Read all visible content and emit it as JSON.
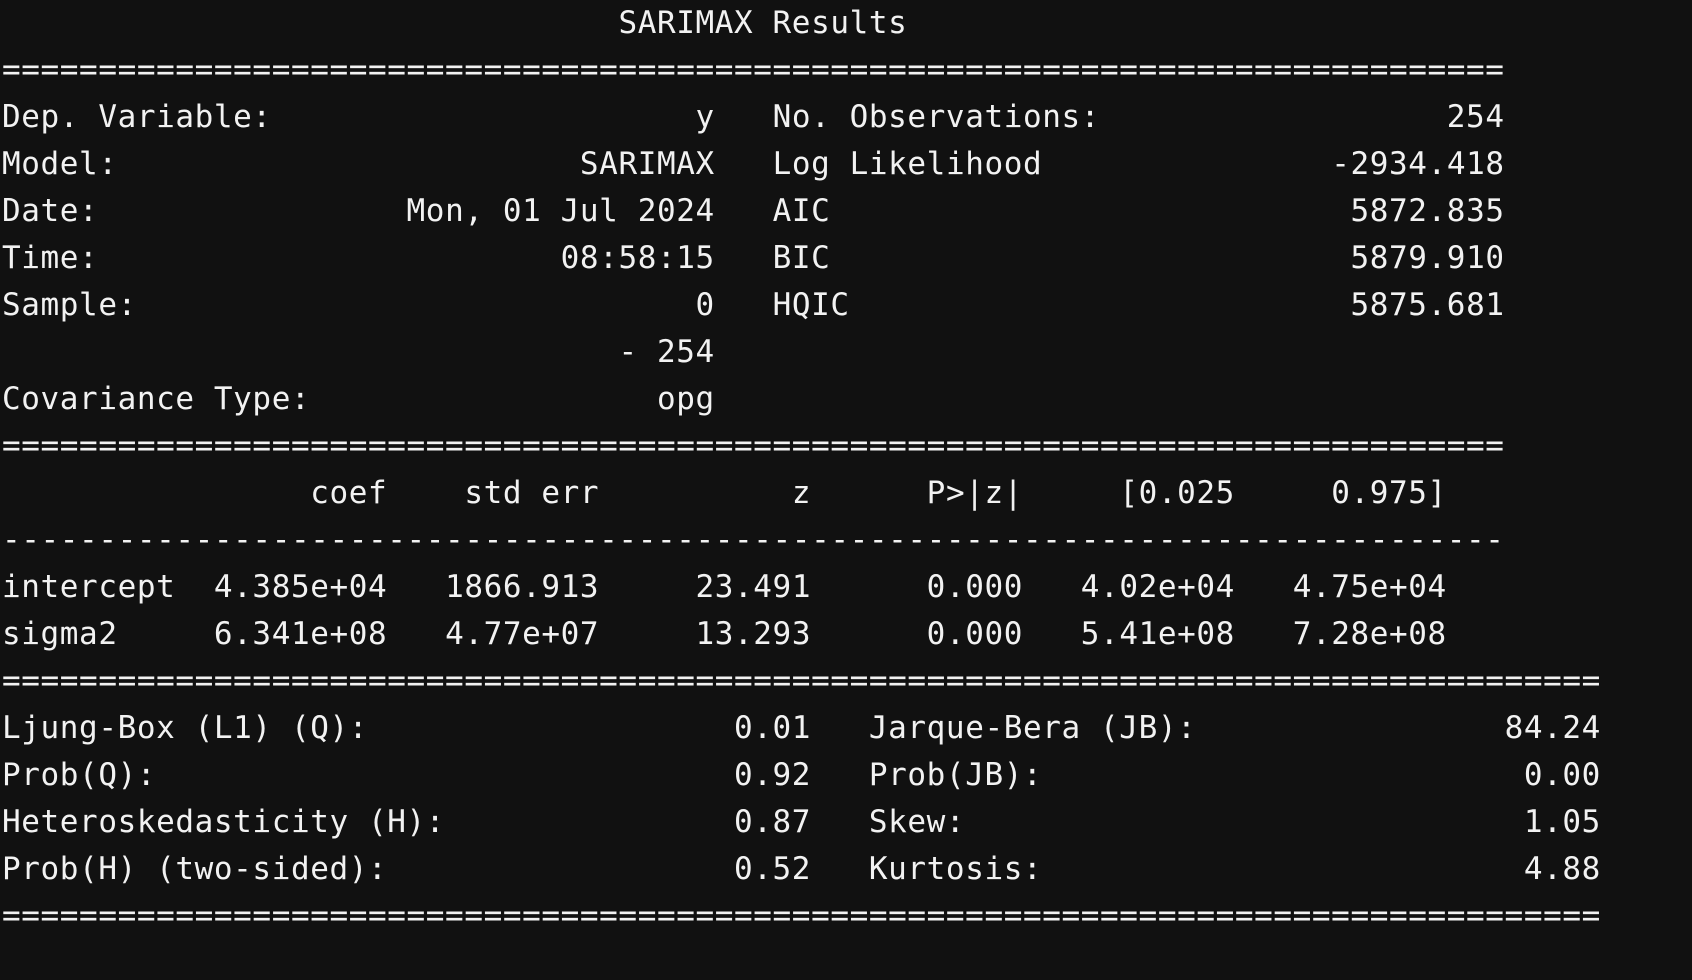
{
  "title": "SARIMAX Results",
  "sep_equal": "==============================================================================",
  "sep_equal_long": "===================================================================================",
  "sep_dash": "------------------------------------------------------------------------------",
  "header_table": {
    "rows": [
      {
        "l_label": "Dep. Variable:",
        "l_value": "y",
        "r_label": "No. Observations:",
        "r_value": "254"
      },
      {
        "l_label": "Model:",
        "l_value": "SARIMAX",
        "r_label": "Log Likelihood",
        "r_value": "-2934.418"
      },
      {
        "l_label": "Date:",
        "l_value": "Mon, 01 Jul 2024",
        "r_label": "AIC",
        "r_value": "5872.835"
      },
      {
        "l_label": "Time:",
        "l_value": "08:58:15",
        "r_label": "BIC",
        "r_value": "5879.910"
      },
      {
        "l_label": "Sample:",
        "l_value": "0",
        "r_label": "HQIC",
        "r_value": "5875.681"
      },
      {
        "l_label": "",
        "l_value": "- 254",
        "r_label": "",
        "r_value": ""
      },
      {
        "l_label": "Covariance Type:",
        "l_value": "opg",
        "r_label": "",
        "r_value": ""
      }
    ]
  },
  "coef_table": {
    "headers": [
      "",
      "coef",
      "std err",
      "z",
      "P>|z|",
      "[0.025",
      "0.975]"
    ],
    "rows": [
      [
        "intercept",
        "4.385e+04",
        "1866.913",
        "23.491",
        "0.000",
        "4.02e+04",
        "4.75e+04"
      ],
      [
        "sigma2",
        "6.341e+08",
        "4.77e+07",
        "13.293",
        "0.000",
        "5.41e+08",
        "7.28e+08"
      ]
    ]
  },
  "diagnostics": {
    "rows": [
      {
        "l_label": "Ljung-Box (L1) (Q):",
        "l_value": "0.01",
        "r_label": "Jarque-Bera (JB):",
        "r_value": "84.24"
      },
      {
        "l_label": "Prob(Q):",
        "l_value": "0.92",
        "r_label": "Prob(JB):",
        "r_value": "0.00"
      },
      {
        "l_label": "Heteroskedasticity (H):",
        "l_value": "0.87",
        "r_label": "Skew:",
        "r_value": "1.05"
      },
      {
        "l_label": "Prob(H) (two-sided):",
        "l_value": "0.52",
        "r_label": "Kurtosis:",
        "r_value": "4.88"
      }
    ]
  }
}
